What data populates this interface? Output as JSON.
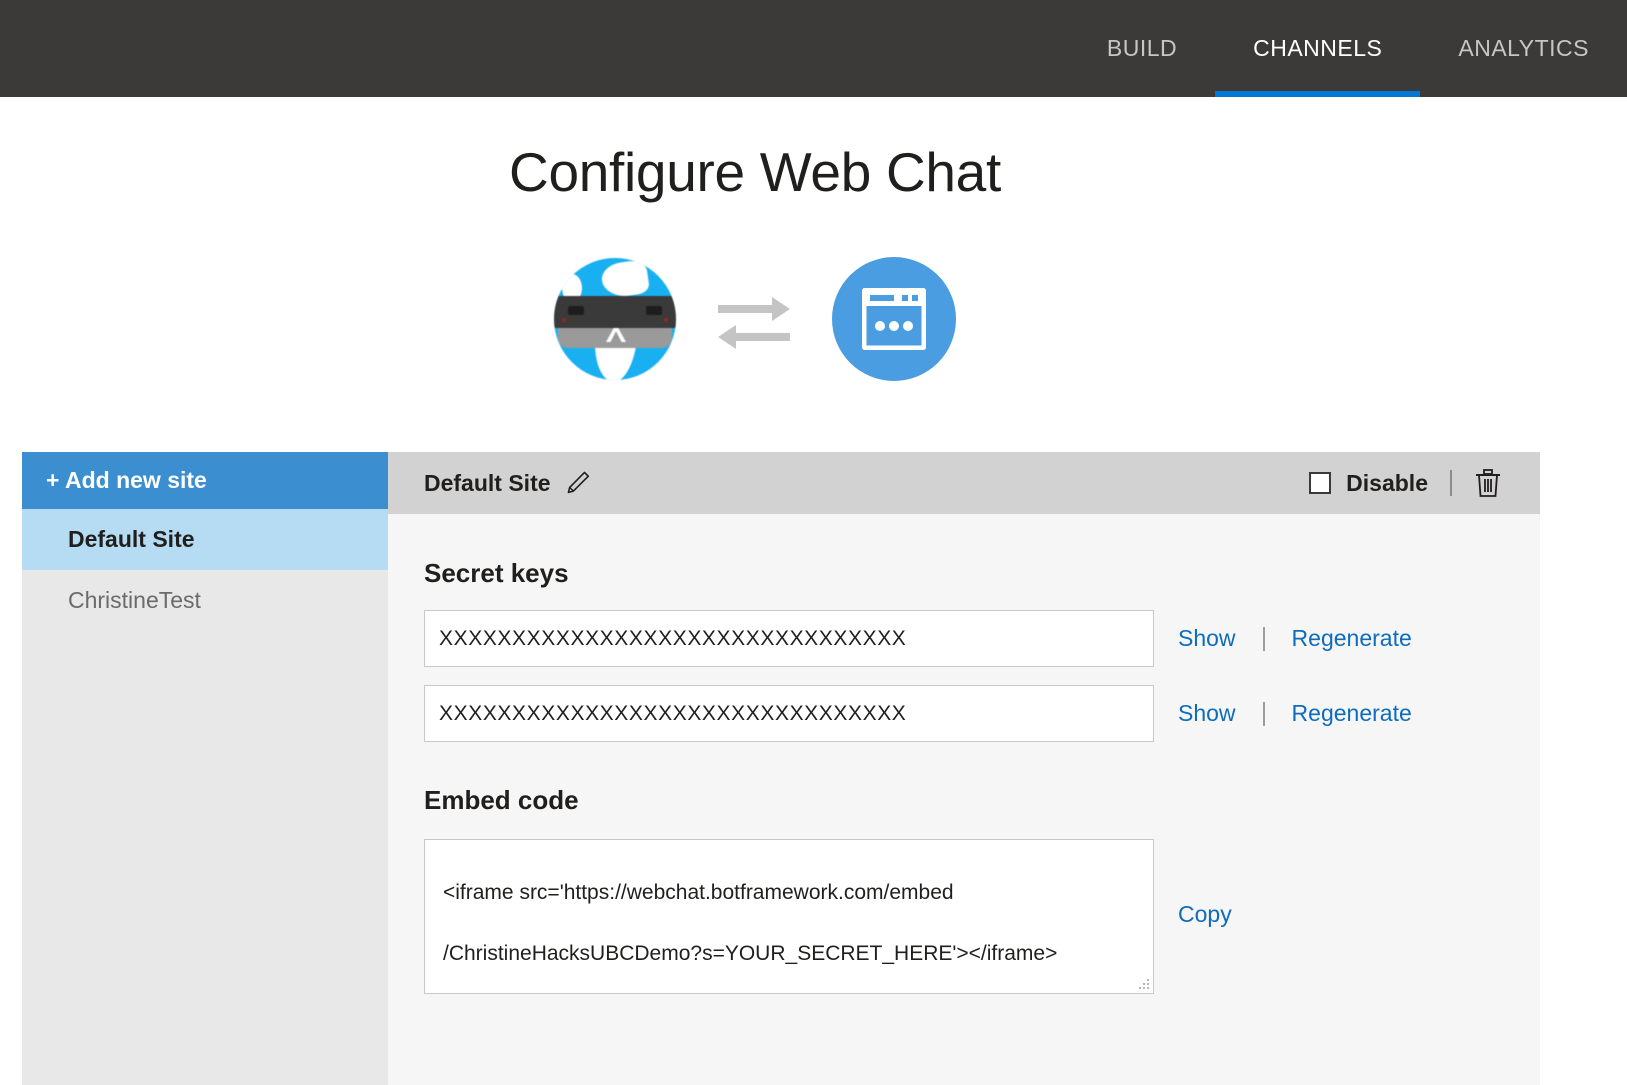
{
  "topnav": {
    "items": [
      {
        "label": "BUILD",
        "active": false
      },
      {
        "label": "CHANNELS",
        "active": true
      },
      {
        "label": "ANALYTICS",
        "active": false
      }
    ],
    "background_color": "#3b3a39",
    "accent_color": "#0078d4"
  },
  "page": {
    "title": "Configure Web Chat",
    "graphic": {
      "bot_icon": "globe-with-visor-avatar",
      "exchange_icon": "bidirectional-arrows-icon",
      "channel_icon": "web-chat-window-icon",
      "channel_icon_color": "#4a9de0"
    }
  },
  "sidebar": {
    "add_new_site_label": "+ Add new site",
    "add_new_site_color": "#3b8fd0",
    "items": [
      {
        "label": "Default Site",
        "selected": true
      },
      {
        "label": "ChristineTest",
        "selected": false
      }
    ],
    "selected_color": "#b5dcf2"
  },
  "detail": {
    "header": {
      "title": "Default Site",
      "edit_icon": "pencil-icon",
      "disable_label": "Disable",
      "disable_checked": false,
      "delete_icon": "trash-icon"
    },
    "secret_keys": {
      "label": "Secret keys",
      "keys": [
        {
          "value": "XXXXXXXXXXXXXXXXXXXXXXXXXXXXXXXX",
          "show_label": "Show",
          "regenerate_label": "Regenerate"
        },
        {
          "value": "XXXXXXXXXXXXXXXXXXXXXXXXXXXXXXXX",
          "show_label": "Show",
          "regenerate_label": "Regenerate"
        }
      ]
    },
    "embed": {
      "label": "Embed code",
      "code": "<iframe src='https://webchat.botframework.com/embed\n/ChristineHacksUBCDemo?s=YOUR_SECRET_HERE'></iframe>",
      "copy_label": "Copy"
    },
    "link_color": "#0f6cbd"
  }
}
